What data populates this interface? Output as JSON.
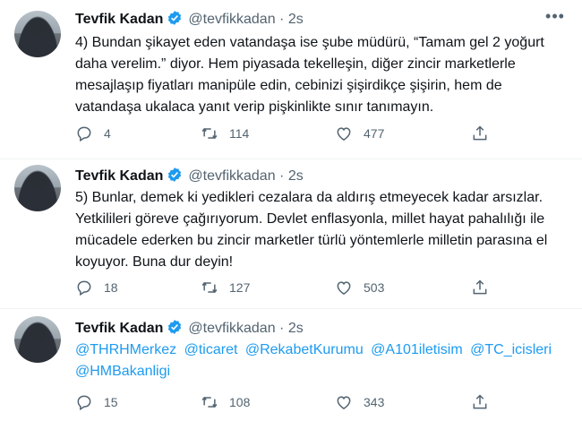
{
  "colors": {
    "link": "#1d9bf0",
    "secondary": "#536471",
    "text": "#0f1419",
    "divider": "#eff3f4"
  },
  "tweets": [
    {
      "author": "Tevfik Kadan",
      "handle": "@tevfikkadan",
      "separator": "·",
      "time": "2s",
      "lines": [
        "4) Bundan şikayet eden vatandaşa ise şube müdürü, “Tamam gel 2 yoğurt",
        "daha verelim.” diyor. Hem piyasada tekelleşin, diğer zincir marketlerle",
        "mesajlaşıp fiyatları manipüle edin, cebinizi şişirdikçe şişirin, hem de",
        "vatandaşa ukalaca yanıt verip pişkinlikte sınır tanımayın."
      ],
      "replies": "4",
      "retweets": "114",
      "likes": "477"
    },
    {
      "author": "Tevfik Kadan",
      "handle": "@tevfikkadan",
      "separator": "·",
      "time": "2s",
      "lines": [
        "5) Bunlar, demek ki yedikleri cezalara da aldırış etmeyecek kadar arsızlar.",
        "Yetkilileri göreve çağırıyorum. Devlet enflasyonla, millet hayat pahalılığı ile",
        "mücadele ederken bu zincir marketler türlü yöntemlerle milletin parasına el",
        "koyuyor. Buna dur deyin!"
      ],
      "replies": "18",
      "retweets": "127",
      "likes": "503"
    },
    {
      "author": "Tevfik Kadan",
      "handle": "@tevfikkadan",
      "separator": "·",
      "time": "2s",
      "mentions": [
        "@THRHMerkez",
        "@ticaret",
        "@RekabetKurumu",
        "@A101iletisim",
        "@TC_icisleri",
        "@HMBakanligi"
      ],
      "replies": "15",
      "retweets": "108",
      "likes": "343"
    }
  ],
  "icons": [
    "verified-badge-icon",
    "more-icon",
    "reply-icon",
    "retweet-icon",
    "like-icon",
    "share-icon"
  ]
}
